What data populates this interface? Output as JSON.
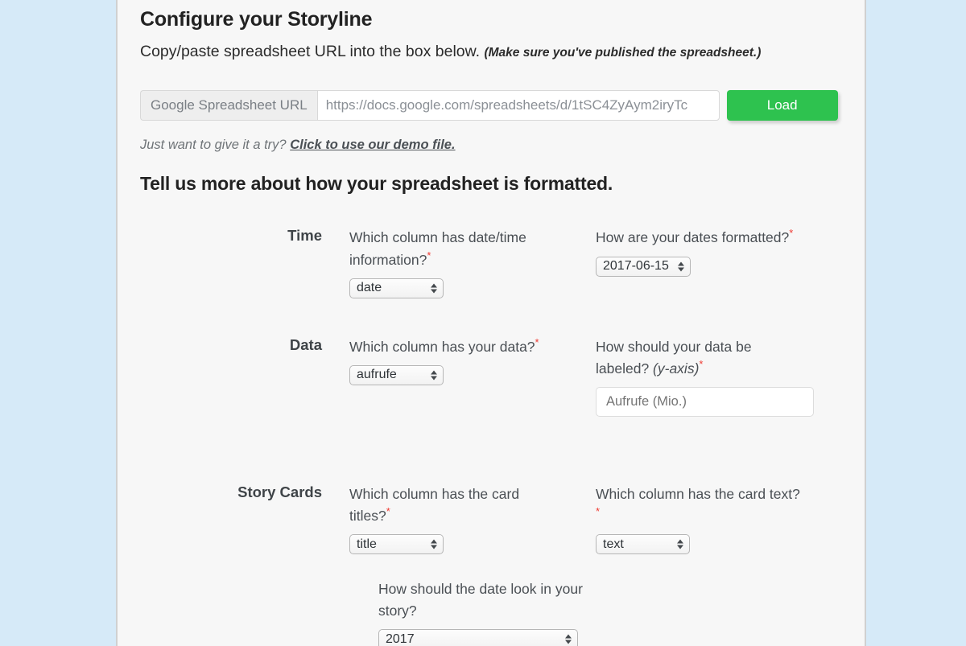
{
  "header": {
    "title": "Configure your Storyline",
    "subtitle": "Copy/paste spreadsheet URL into the box below.",
    "subtitle_note": "(Make sure you've published the spreadsheet.)"
  },
  "url_bar": {
    "addon_label": "Google Spreadsheet URL",
    "value": "https://docs.google.com/spreadsheets/d/1tSC4ZyAym2iryTc",
    "load_label": "Load"
  },
  "demo": {
    "prompt": "Just want to give it a try?",
    "link": "Click to use our demo file."
  },
  "form": {
    "heading": "Tell us more about how your spreadsheet is formatted.",
    "rows": [
      {
        "label": "Time",
        "fields": [
          {
            "question": "Which column has date/time information?",
            "required": true,
            "control": "select",
            "value": "date"
          },
          {
            "question": "How are your dates formatted?",
            "required": true,
            "control": "select",
            "value": "2017-06-15"
          }
        ]
      },
      {
        "label": "Data",
        "fields": [
          {
            "question": "Which column has your data?",
            "required": true,
            "control": "select",
            "value": "aufrufe"
          },
          {
            "question": "How should your data be labeled?",
            "question_italic": "(y-axis)",
            "required": true,
            "control": "text",
            "placeholder": "Aufrufe (Mio.)",
            "value": ""
          }
        ]
      },
      {
        "label": "Story Cards",
        "fields": [
          {
            "question": "Which column has the card titles?",
            "required": true,
            "control": "select",
            "value": "title"
          },
          {
            "question": "Which column has the card text?",
            "required": true,
            "control": "select",
            "value": "text"
          }
        ]
      },
      {
        "label": "",
        "fields": [
          {
            "question": "How should the date look in your story?",
            "required": false,
            "control": "select",
            "value": "2017"
          }
        ]
      }
    ]
  },
  "colors": {
    "page_background": "#d6eaf8",
    "panel_background": "#f7f7f7",
    "accent_green": "#2ec24f",
    "required_red": "#ef3b33"
  }
}
